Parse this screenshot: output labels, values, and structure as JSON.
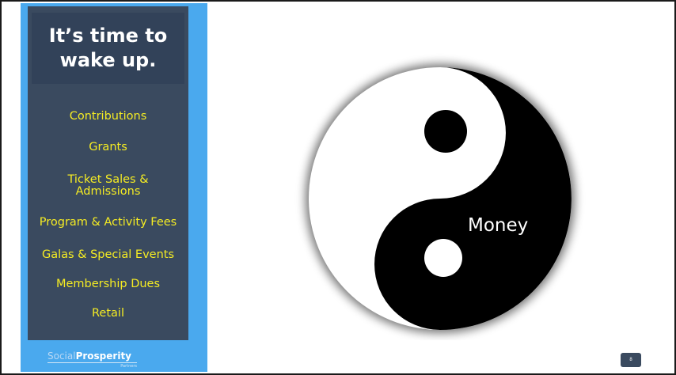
{
  "slide": {
    "title": "It’s time to wake up.",
    "revenue_items": [
      "Contributions",
      "Grants",
      "Ticket Sales &",
      "Admissions",
      "Program & Activity Fees",
      "Galas & Special Events",
      "Membership Dues",
      "Retail"
    ],
    "graphic_label": "Money",
    "page_number": "8"
  },
  "brand": {
    "part1": "Social",
    "part2": "Prosperity",
    "sub": "Partners"
  },
  "colors": {
    "sidebar_blue": "#4aa9ee",
    "panel_navy": "#3a4a5f",
    "item_yellow": "#f5ec23"
  }
}
